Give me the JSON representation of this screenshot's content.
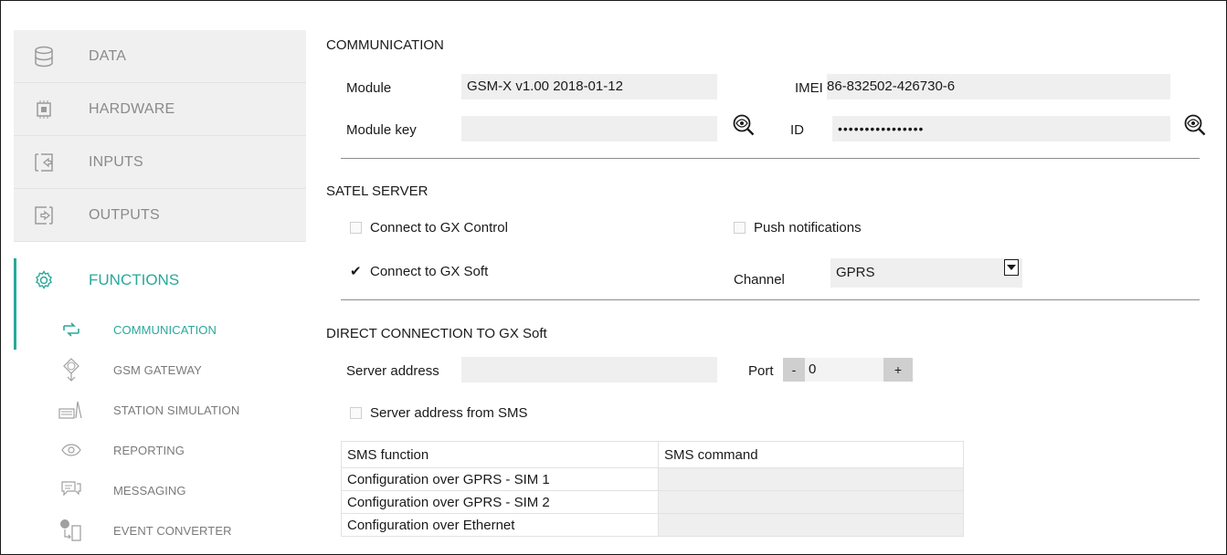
{
  "sidebar": {
    "categories": [
      {
        "label": "DATA",
        "icon": "database-icon"
      },
      {
        "label": "HARDWARE",
        "icon": "chip-icon"
      },
      {
        "label": "INPUTS",
        "icon": "input-icon"
      },
      {
        "label": "OUTPUTS",
        "icon": "output-icon"
      }
    ],
    "functions": {
      "label": "FUNCTIONS",
      "icon": "gear-icon"
    },
    "sub_items": [
      {
        "label": "COMMUNICATION",
        "icon": "communication-icon",
        "active": true
      },
      {
        "label": "GSM GATEWAY",
        "icon": "gsm-gateway-icon"
      },
      {
        "label": "STATION SIMULATION",
        "icon": "station-icon"
      },
      {
        "label": "REPORTING",
        "icon": "eye-icon"
      },
      {
        "label": "MESSAGING",
        "icon": "message-icon"
      },
      {
        "label": "EVENT CONVERTER",
        "icon": "converter-icon"
      }
    ],
    "accent": "#29a89b"
  },
  "communication": {
    "title": "COMMUNICATION",
    "module_label": "Module",
    "module_value": "GSM-X v1.00 2018-01-12",
    "imei_label": "IMEI",
    "imei_value": "86-832502-426730-6",
    "module_key_label": "Module key",
    "module_key_value": "",
    "id_label": "ID",
    "id_value": "••••••••••••••••"
  },
  "satel": {
    "title": "SATEL SERVER",
    "connect_gx_control": {
      "label": "Connect to GX Control",
      "checked": false
    },
    "push_notifications": {
      "label": "Push notifications",
      "checked": false
    },
    "connect_gx_soft": {
      "label": "Connect to GX Soft",
      "checked": true
    },
    "channel_label": "Channel",
    "channel_value": "GPRS"
  },
  "direct": {
    "title": "DIRECT CONNECTION TO GX Soft",
    "server_address_label": "Server address",
    "server_address_value": "",
    "port_label": "Port",
    "port_minus": "-",
    "port_value": "0",
    "port_plus": "+",
    "server_from_sms": {
      "label": "Server address from SMS",
      "checked": false
    }
  },
  "sms_table": {
    "headers": [
      "SMS function",
      "SMS command"
    ],
    "rows": [
      {
        "function": "Configuration over GPRS - SIM 1",
        "command": ""
      },
      {
        "function": "Configuration over GPRS - SIM 2",
        "command": ""
      },
      {
        "function": "Configuration over Ethernet",
        "command": ""
      }
    ]
  }
}
